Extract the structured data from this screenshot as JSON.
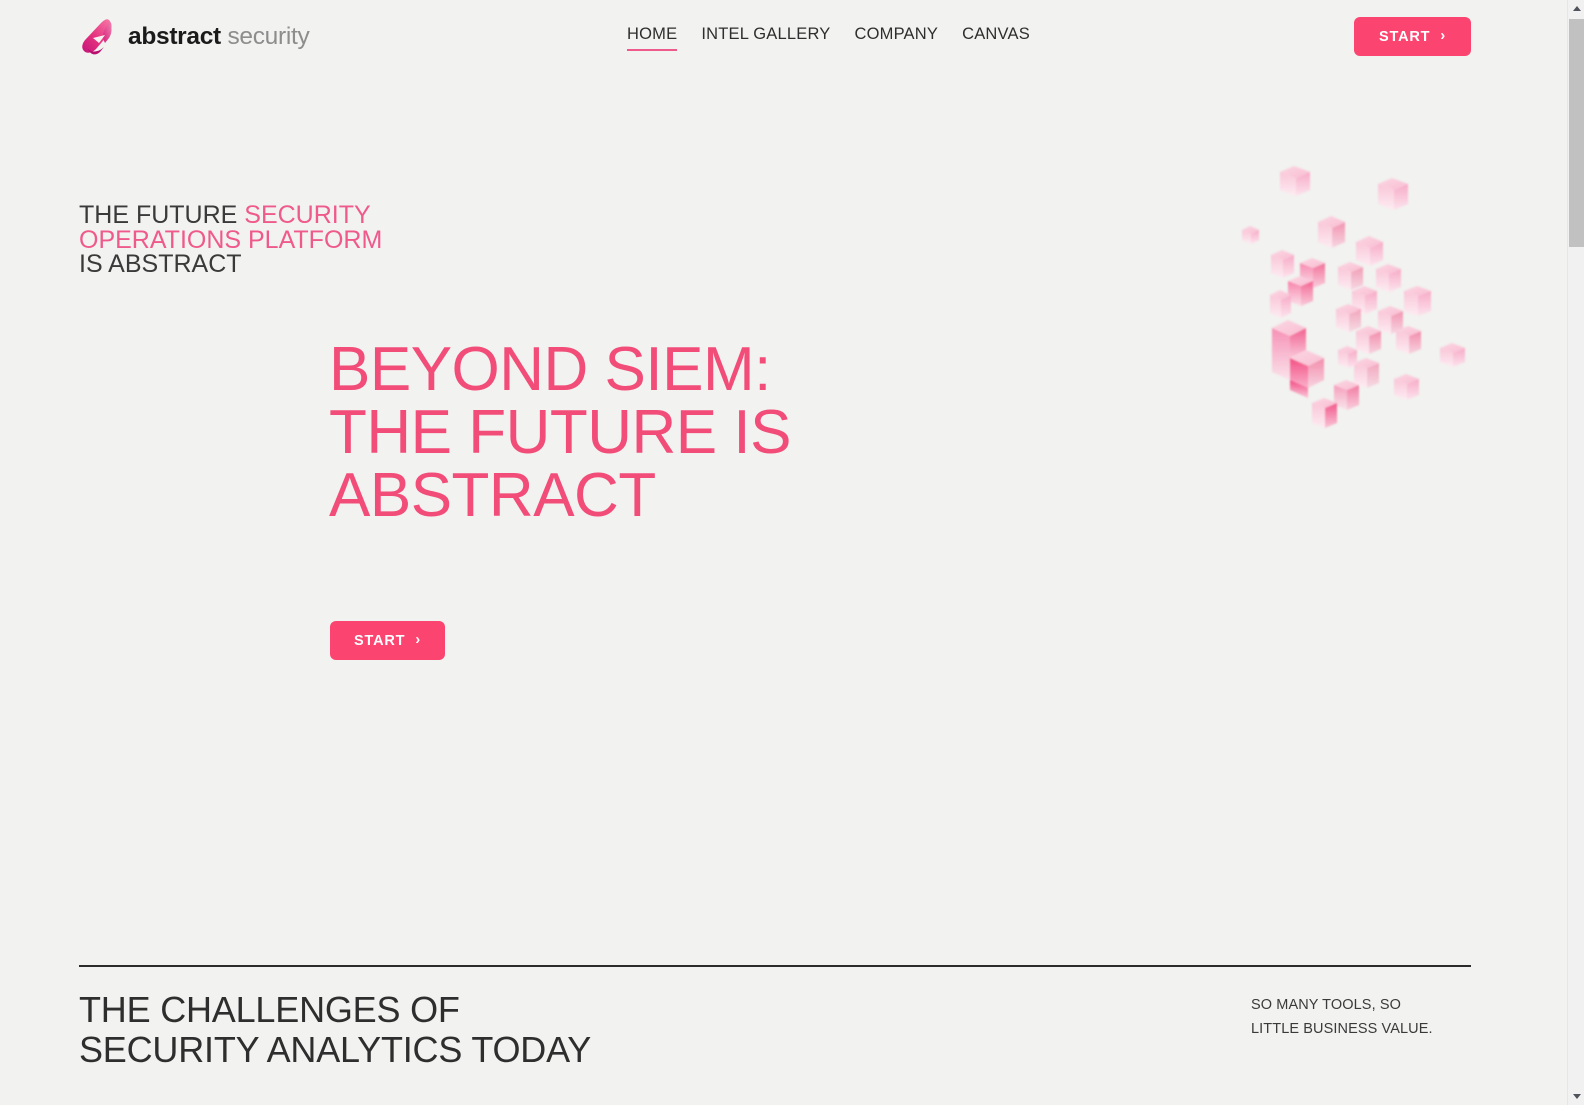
{
  "brand": {
    "name_bold": "abstract",
    "name_light": "security",
    "logo_icon": "abstract-a-logo-icon",
    "accent_pink": "#fb4570",
    "accent_pink_soft": "#ef5a8c",
    "headline_pink": "#f24d79",
    "background": "#f2f2f0",
    "text_dark": "#2e2e2e"
  },
  "nav": {
    "items": [
      {
        "label": "HOME",
        "active": true
      },
      {
        "label": "INTEL GALLERY",
        "active": false
      },
      {
        "label": "COMPANY",
        "active": false
      },
      {
        "label": "CANVAS",
        "active": false
      }
    ],
    "cta": {
      "label": "START",
      "icon": "chevron-right-icon",
      "glyph": "›"
    }
  },
  "hero": {
    "tagline": {
      "lead": "THE FUTURE ",
      "highlight": "SECURITY OPERATIONS PLATFORM",
      "tail": "IS ABSTRACT"
    },
    "headline_line1": "BEYOND SIEM:",
    "headline_line2": "THE FUTURE IS",
    "headline_line3": "ABSTRACT",
    "cta": {
      "label": "START",
      "icon": "chevron-right-icon",
      "glyph": "›"
    },
    "graphic": "isometric-pink-cubes-illustration"
  },
  "section": {
    "title_line1": "THE CHALLENGES OF",
    "title_line2": "SECURITY ANALYTICS TODAY",
    "subtitle_line1": "SO MANY TOOLS, SO",
    "subtitle_line2": "LITTLE BUSINESS VALUE."
  },
  "scrollbar": {
    "up_icon": "scroll-up-arrow-icon",
    "down_icon": "scroll-down-arrow-icon",
    "thumb": "scrollbar-thumb"
  }
}
